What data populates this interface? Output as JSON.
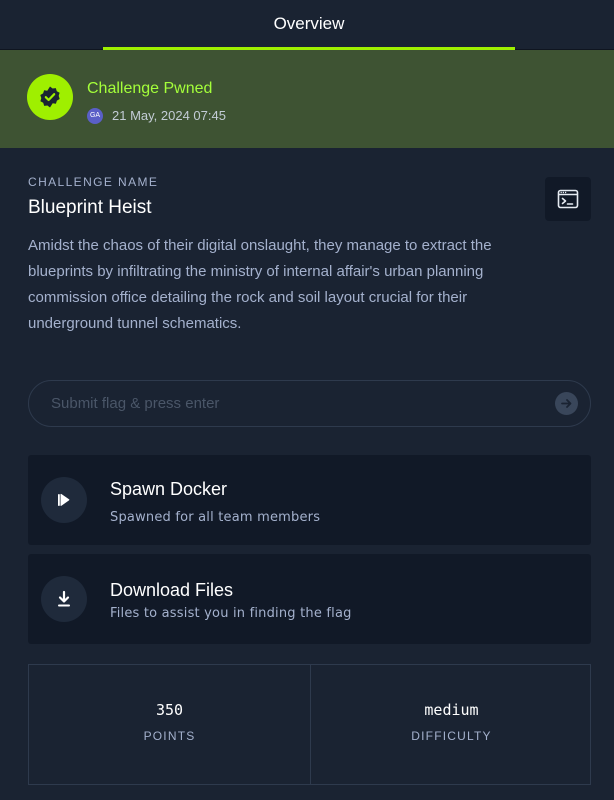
{
  "tabs": {
    "overview_label": "Overview"
  },
  "pwned": {
    "title": "Challenge Pwned",
    "avatar_initials": "GA",
    "date": "21 May, 2024 07:45"
  },
  "challenge": {
    "name_label": "CHALLENGE NAME",
    "name": "Blueprint Heist",
    "description": "Amidst the chaos of their digital onslaught, they manage to extract the blueprints by infiltrating the ministry of internal affair's urban planning commission office detailing the rock and soil layout crucial for their underground tunnel schematics."
  },
  "flag": {
    "placeholder": "Submit flag & press enter"
  },
  "actions": {
    "spawn": {
      "title": "Spawn Docker",
      "subtitle": "Spawned for all team members"
    },
    "download": {
      "title": "Download Files",
      "subtitle": "Files to assist you in finding the flag"
    }
  },
  "stats": {
    "points_value": "350",
    "points_label": "POINTS",
    "difficulty_value": "medium",
    "difficulty_label": "DIFFICULTY"
  },
  "colors": {
    "accent": "#9fef00",
    "background": "#1a2332",
    "card": "#111927",
    "pwned_banner": "#3e5333"
  },
  "icons": {
    "pwned": "verified-check-icon",
    "terminal": "terminal-window-icon",
    "submit": "arrow-right-icon",
    "spawn": "play-icon",
    "download": "download-icon"
  }
}
